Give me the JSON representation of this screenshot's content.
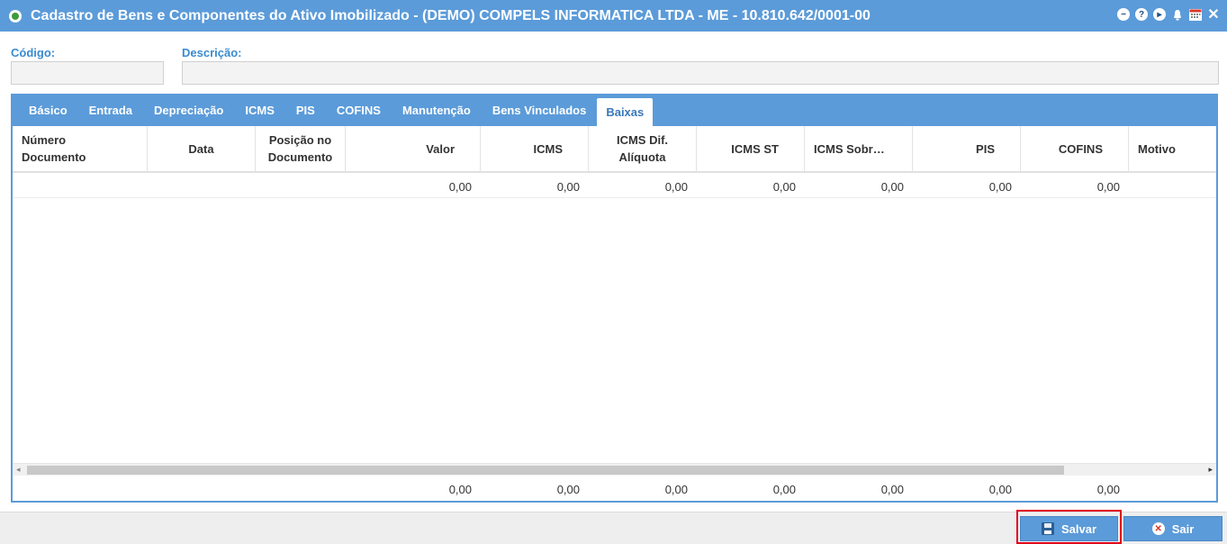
{
  "window": {
    "title": "Cadastro de Bens e Componentes do Ativo Imobilizado - (DEMO) COMPELS INFORMATICA LTDA - ME - 10.810.642/0001-00"
  },
  "fields": {
    "codigo_label": "Código:",
    "codigo_value": "",
    "descricao_label": "Descrição:",
    "descricao_value": ""
  },
  "tabs": [
    {
      "label": "Básico",
      "active": false
    },
    {
      "label": "Entrada",
      "active": false
    },
    {
      "label": "Depreciação",
      "active": false
    },
    {
      "label": "ICMS",
      "active": false
    },
    {
      "label": "PIS",
      "active": false
    },
    {
      "label": "COFINS",
      "active": false
    },
    {
      "label": "Manutenção",
      "active": false
    },
    {
      "label": "Bens Vinculados",
      "active": false
    },
    {
      "label": "Baixas",
      "active": true
    }
  ],
  "grid": {
    "columns": [
      {
        "l1": "Número",
        "l2": "Documento"
      },
      {
        "l1": "Data",
        "l2": ""
      },
      {
        "l1": "Posição no",
        "l2": "Documento"
      },
      {
        "l1": "Valor",
        "l2": ""
      },
      {
        "l1": "ICMS",
        "l2": ""
      },
      {
        "l1": "ICMS Dif.",
        "l2": "Alíquota"
      },
      {
        "l1": "ICMS ST",
        "l2": ""
      },
      {
        "l1": "ICMS Sobr…",
        "l2": ""
      },
      {
        "l1": "PIS",
        "l2": ""
      },
      {
        "l1": "COFINS",
        "l2": ""
      },
      {
        "l1": "Motivo",
        "l2": ""
      }
    ],
    "row": [
      "",
      "",
      "",
      "0,00",
      "0,00",
      "0,00",
      "0,00",
      "0,00",
      "0,00",
      "0,00",
      ""
    ],
    "totals": [
      "",
      "",
      "",
      "0,00",
      "0,00",
      "0,00",
      "0,00",
      "0,00",
      "0,00",
      "0,00",
      ""
    ]
  },
  "buttons": {
    "salvar": "Salvar",
    "sair": "Sair"
  },
  "icons": {
    "title": "refresh-icon",
    "actions": [
      "minus-circle-icon",
      "help-icon",
      "play-icon",
      "bell-icon",
      "calendar-icon",
      "close-icon"
    ]
  },
  "colors": {
    "accent": "#5b9bd9",
    "label": "#3a8bd0",
    "highlight": "#e0001a"
  }
}
